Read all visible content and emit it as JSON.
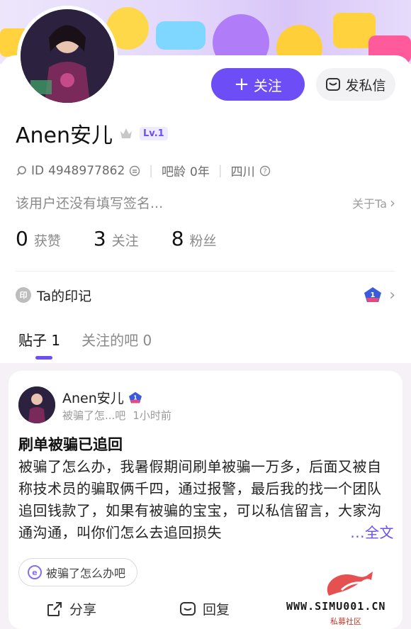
{
  "profile": {
    "name": "Anen安儿",
    "level": "Lv.1",
    "id_label": "ID",
    "id_value": "4948977862",
    "age_label": "吧龄",
    "age_value": "0年",
    "location": "四川",
    "signature": "该用户还没有填写签名...",
    "about_label": "关于Ta"
  },
  "actions": {
    "follow_label": "关注",
    "message_label": "发私信"
  },
  "stats": [
    {
      "num": "0",
      "label": "获赞"
    },
    {
      "num": "3",
      "label": "关注"
    },
    {
      "num": "8",
      "label": "粉丝"
    }
  ],
  "imprint": {
    "badge": "印",
    "label": "Ta的印记"
  },
  "tabs": [
    {
      "label": "贴子 1",
      "active": true
    },
    {
      "label": "关注的吧 0",
      "active": false
    }
  ],
  "post": {
    "author": "Anen安儿",
    "forum": "被骗了怎...吧",
    "time": "1小时前",
    "title": "刷单被骗已追回",
    "body": "被骗了怎么办，我暑假期间刷单被骗一万多，后面又被自称技术员的骗取俩千四，通过报警，最后我的找一个团队追回钱款了，如果有被骗的宝宝，可以私信留言，大家沟通沟通，叫你们怎么去追回损失",
    "more_label": "...全文",
    "tag": "被骗了怎么办吧",
    "share_label": "分享",
    "reply_label": "回复"
  },
  "watermark": {
    "text": "WWW.SIMU001.CN",
    "sub": "私募社区"
  },
  "colors": {
    "accent": "#6d4ef6",
    "feed_bg": "#f5f1f6"
  }
}
